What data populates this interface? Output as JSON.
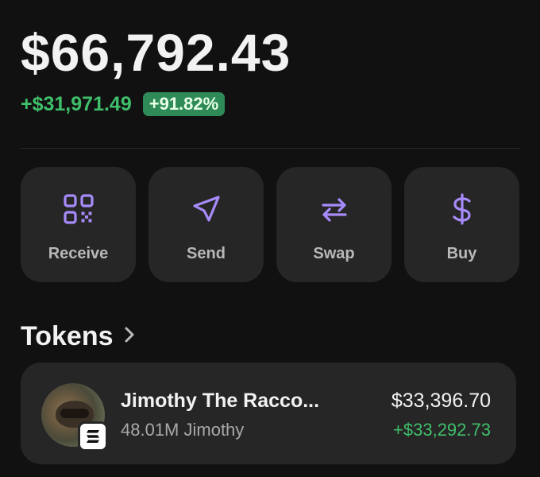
{
  "balance": {
    "total": "$66,792.43",
    "change_amount": "+$31,971.49",
    "change_percent": "+91.82%"
  },
  "actions": [
    {
      "label": "Receive",
      "icon": "qr-code-icon"
    },
    {
      "label": "Send",
      "icon": "send-icon"
    },
    {
      "label": "Swap",
      "icon": "swap-icon"
    },
    {
      "label": "Buy",
      "icon": "dollar-icon"
    }
  ],
  "tokens": {
    "title": "Tokens",
    "items": [
      {
        "name": "Jimothy The Racco...",
        "amount": "48.01M Jimothy",
        "value": "$33,396.70",
        "change": "+$33,292.73",
        "chain_icon": "solana-icon"
      }
    ]
  },
  "colors": {
    "background": "#111111",
    "card": "#262626",
    "accent": "#a78bfa",
    "positive": "#3fbf6a",
    "badge": "#2e8b57"
  }
}
